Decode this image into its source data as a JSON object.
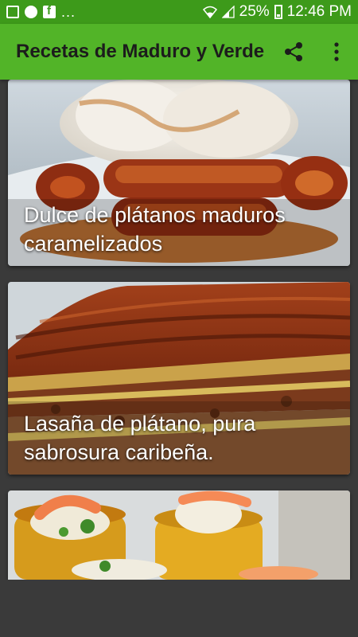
{
  "status_bar": {
    "more": "...",
    "battery": "25%",
    "time": "12:46 PM",
    "icons": [
      "gallery-icon",
      "chat-icon",
      "facebook-icon",
      "wifi-icon",
      "signal-icon",
      "battery-icon"
    ]
  },
  "app_bar": {
    "title": "Recetas de Maduro y Verde",
    "share_icon": "share-icon",
    "menu_icon": "overflow-menu-icon"
  },
  "recipes": [
    {
      "title": "Dulce de plátanos maduros caramelizados"
    },
    {
      "title": "Lasaña de plátano, pura sabrosura caribeña."
    },
    {
      "title": ""
    }
  ],
  "colors": {
    "status_bar": "#3d9a1a",
    "app_bar": "#52b428",
    "background": "#3a3a3a"
  }
}
